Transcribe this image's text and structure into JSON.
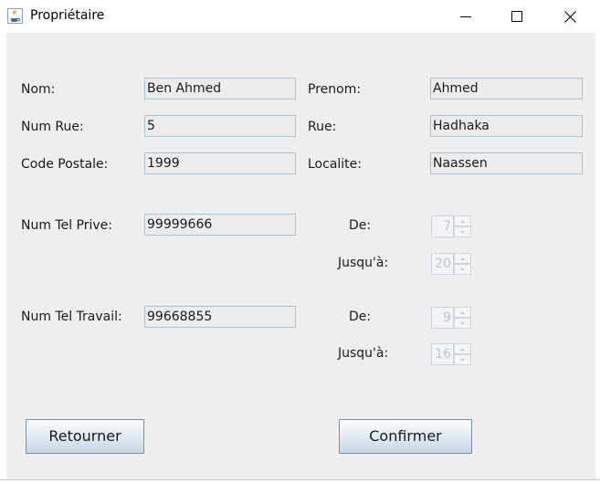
{
  "window": {
    "title": "Propriétaire",
    "icon": "java-coffee-icon",
    "controls": [
      "minimize-icon",
      "maximize-icon",
      "close-icon"
    ]
  },
  "form": {
    "nom": {
      "label": "Nom:",
      "value": "Ben Ahmed"
    },
    "prenom": {
      "label": "Prenom:",
      "value": "Ahmed"
    },
    "num_rue": {
      "label": "Num Rue:",
      "value": "5"
    },
    "rue": {
      "label": "Rue:",
      "value": "Hadhaka"
    },
    "code_postale": {
      "label": "Code Postale:",
      "value": "1999"
    },
    "localite": {
      "label": "Localite:",
      "value": "Naassen"
    },
    "tel_prive": {
      "label": "Num Tel Prive:",
      "value": "99999666",
      "de_label": "De:",
      "de_value": "7",
      "jusqua_label": "Jusqu'à:",
      "jusqua_value": "20"
    },
    "tel_travail": {
      "label": "Num Tel Travail:",
      "value": "99668855",
      "de_label": "De:",
      "de_value": "9",
      "jusqua_label": "Jusqu'à:",
      "jusqua_value": "16"
    }
  },
  "buttons": {
    "retourner": "Retourner",
    "confirmer": "Confirmer"
  },
  "colors": {
    "panel": "#eeeeee",
    "field_border": "#a8c3dc",
    "spinner_text_disabled": "#b9c6d6"
  }
}
